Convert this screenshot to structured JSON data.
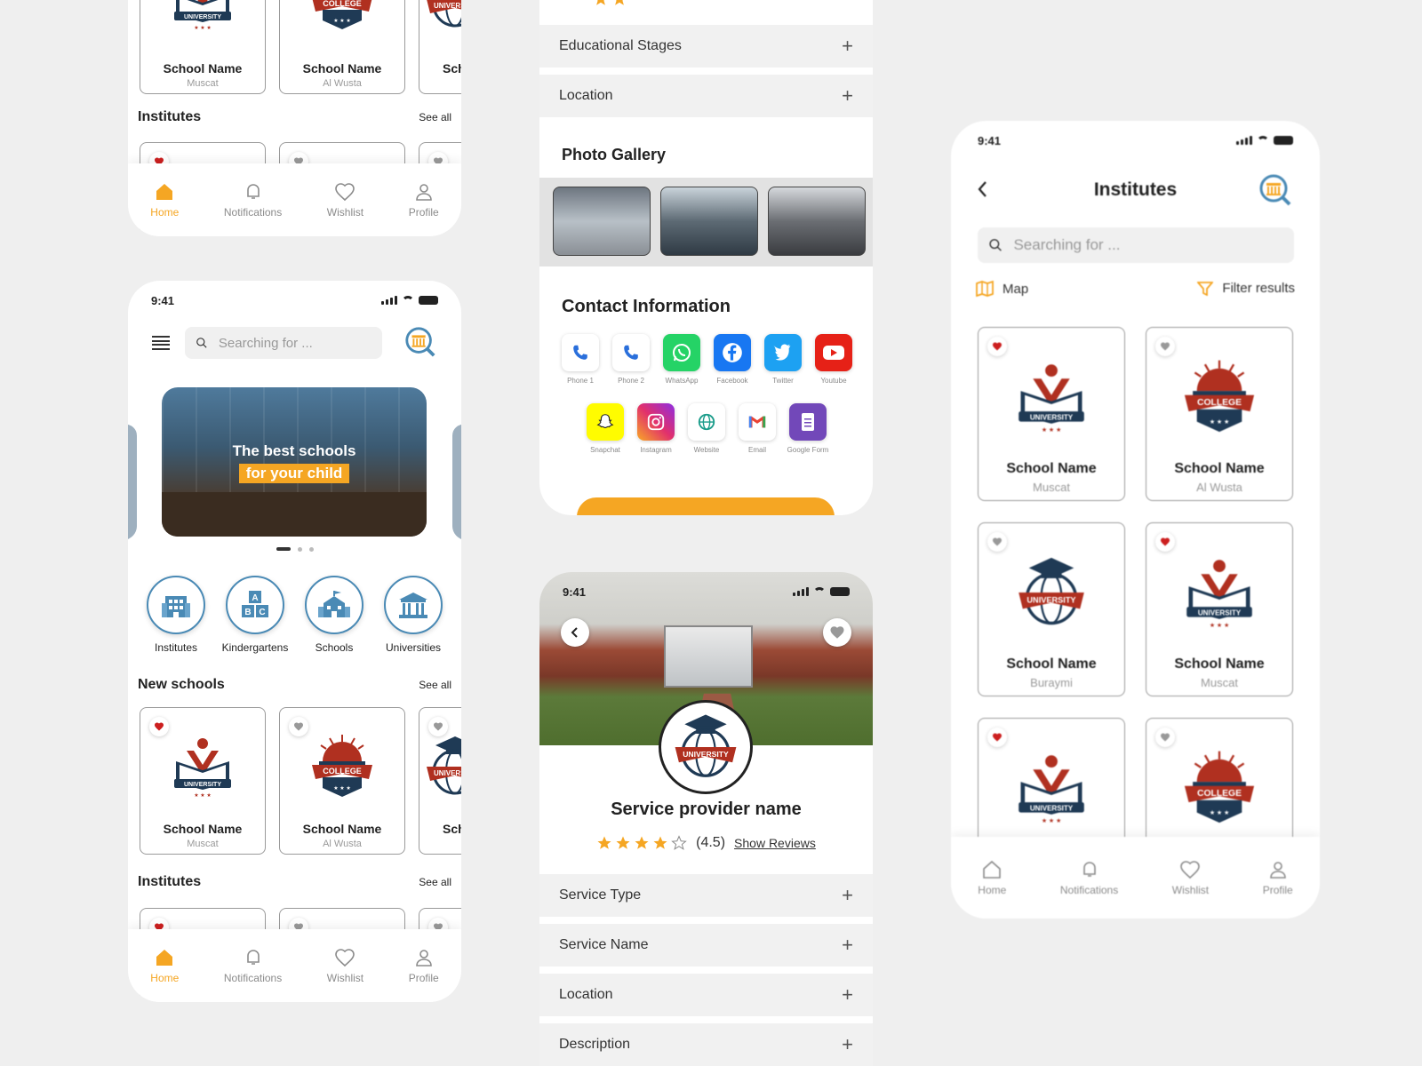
{
  "colors": {
    "accent": "#f5a623",
    "brand_blue": "#4a8ab5",
    "heart_red": "#cc1f1f",
    "navy": "#1f3a55"
  },
  "status": {
    "time": "9:41"
  },
  "tabs": [
    {
      "label": "Home",
      "icon": "home-icon"
    },
    {
      "label": "Notifications",
      "icon": "bell-icon"
    },
    {
      "label": "Wishlist",
      "icon": "heart-icon"
    },
    {
      "label": "Profile",
      "icon": "user-icon"
    }
  ],
  "home_top": {
    "cards": [
      {
        "name": "School Name",
        "city": "Muscat",
        "logo": "university-logo"
      },
      {
        "name": "School Name",
        "city": "Al Wusta",
        "logo": "college-logo"
      },
      {
        "name": "Sch",
        "city": "",
        "logo": "globe-logo"
      }
    ],
    "institutes_title": "Institutes",
    "see_all": "See all"
  },
  "home": {
    "search_placeholder": "Searching for ...",
    "banner_line1": "The best schools",
    "banner_line2": "for your child",
    "categories": [
      {
        "label": "Institutes",
        "icon": "institute-building-icon"
      },
      {
        "label": "Kindergartens",
        "icon": "abc-blocks-icon"
      },
      {
        "label": "Schools",
        "icon": "school-building-icon"
      },
      {
        "label": "Universities",
        "icon": "university-building-icon"
      }
    ],
    "new_schools_title": "New schools",
    "see_all": "See all",
    "cards": [
      {
        "name": "School Name",
        "city": "Muscat",
        "fav": true
      },
      {
        "name": "School Name",
        "city": "Al Wusta",
        "fav": false
      },
      {
        "name": "Sch",
        "city": "",
        "fav": false
      }
    ],
    "institutes_title": "Institutes"
  },
  "details_top": {
    "accordions": [
      "Educational Stages",
      "Location"
    ],
    "gallery_title": "Photo Gallery",
    "contact_title": "Contact Information",
    "contacts_row1": [
      {
        "label": "Phone 1",
        "icon": "phone-icon",
        "color": "#ffffff"
      },
      {
        "label": "Phone 2",
        "icon": "phone-icon",
        "color": "#ffffff"
      },
      {
        "label": "WhatsApp",
        "icon": "whatsapp-icon",
        "color": "#25d366"
      },
      {
        "label": "Facebook",
        "icon": "facebook-icon",
        "color": "#1877f2"
      },
      {
        "label": "Twitter",
        "icon": "twitter-icon",
        "color": "#1da1f2"
      },
      {
        "label": "Youtube",
        "icon": "youtube-icon",
        "color": "#e62117"
      }
    ],
    "contacts_row2": [
      {
        "label": "Snapchat",
        "icon": "snapchat-icon",
        "color": "#fffc00"
      },
      {
        "label": "Instagram",
        "icon": "instagram-icon",
        "color": "#e1306c"
      },
      {
        "label": "Website",
        "icon": "globe-icon",
        "color": "#ffffff"
      },
      {
        "label": "Email",
        "icon": "gmail-icon",
        "color": "#ffffff"
      },
      {
        "label": "Google Form",
        "icon": "form-icon",
        "color": "#7248b9"
      }
    ]
  },
  "details": {
    "provider_name": "Service provider name",
    "rating": 4.5,
    "rating_text": "(4.5)",
    "show_reviews": "Show Reviews",
    "accordions": [
      "Service Type",
      "Service Name",
      "Location",
      "Description"
    ]
  },
  "institutes": {
    "title": "Institutes",
    "search_placeholder": "Searching for ...",
    "map_label": "Map",
    "filter_label": "Filter results",
    "cards": [
      {
        "name": "School Name",
        "city": "Muscat",
        "fav": true,
        "logo": "university-logo"
      },
      {
        "name": "School Name",
        "city": "Al Wusta",
        "fav": false,
        "logo": "college-logo"
      },
      {
        "name": "School Name",
        "city": "Buraymi",
        "fav": false,
        "logo": "globe-logo"
      },
      {
        "name": "School Name",
        "city": "Muscat",
        "fav": true,
        "logo": "university-logo"
      },
      {
        "name": "",
        "city": "",
        "fav": true,
        "logo": "university-logo"
      },
      {
        "name": "",
        "city": "",
        "fav": false,
        "logo": "college-logo"
      }
    ]
  }
}
